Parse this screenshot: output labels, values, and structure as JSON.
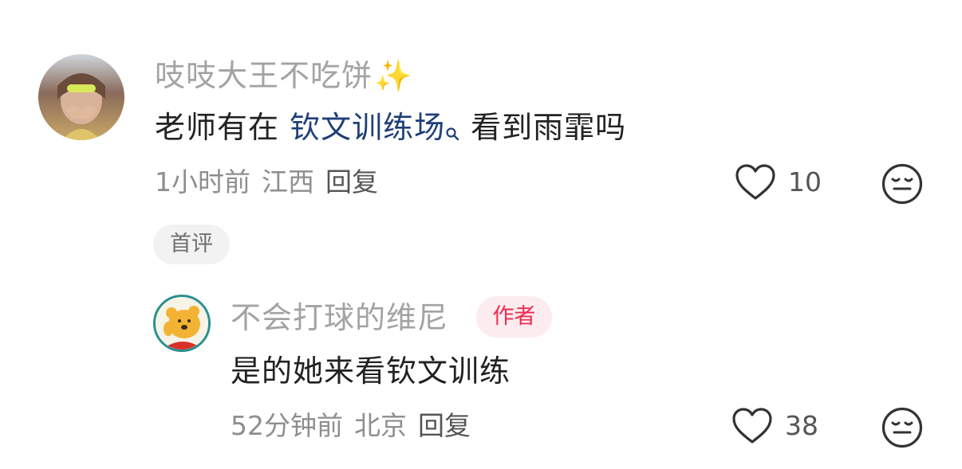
{
  "comments": [
    {
      "username": "吱吱大王不吃饼",
      "username_emoji": "✨",
      "body_prefix": "老师有在 ",
      "body_keyword": "钦文训练场",
      "body_suffix": "看到雨霏吗",
      "time": "1小时前",
      "location": "江西",
      "reply_label": "回复",
      "like_count": "10",
      "badge": "首评"
    },
    {
      "username": "不会打球的维尼",
      "author_badge": "作者",
      "body": "是的她来看钦文训练",
      "time": "52分钟前",
      "location": "北京",
      "reply_label": "回复",
      "like_count": "38"
    }
  ],
  "icons": {
    "like": "heart-outline-icon",
    "emoji": "neutral-face-icon",
    "keyword_search": "search-icon",
    "sparkles": "sparkles-icon"
  },
  "colors": {
    "link": "#1f3f78",
    "author_badge_text": "#ef2a4f",
    "author_badge_bg": "#fdecef",
    "muted_text": "#a3a3a3",
    "body_text": "#222222"
  }
}
